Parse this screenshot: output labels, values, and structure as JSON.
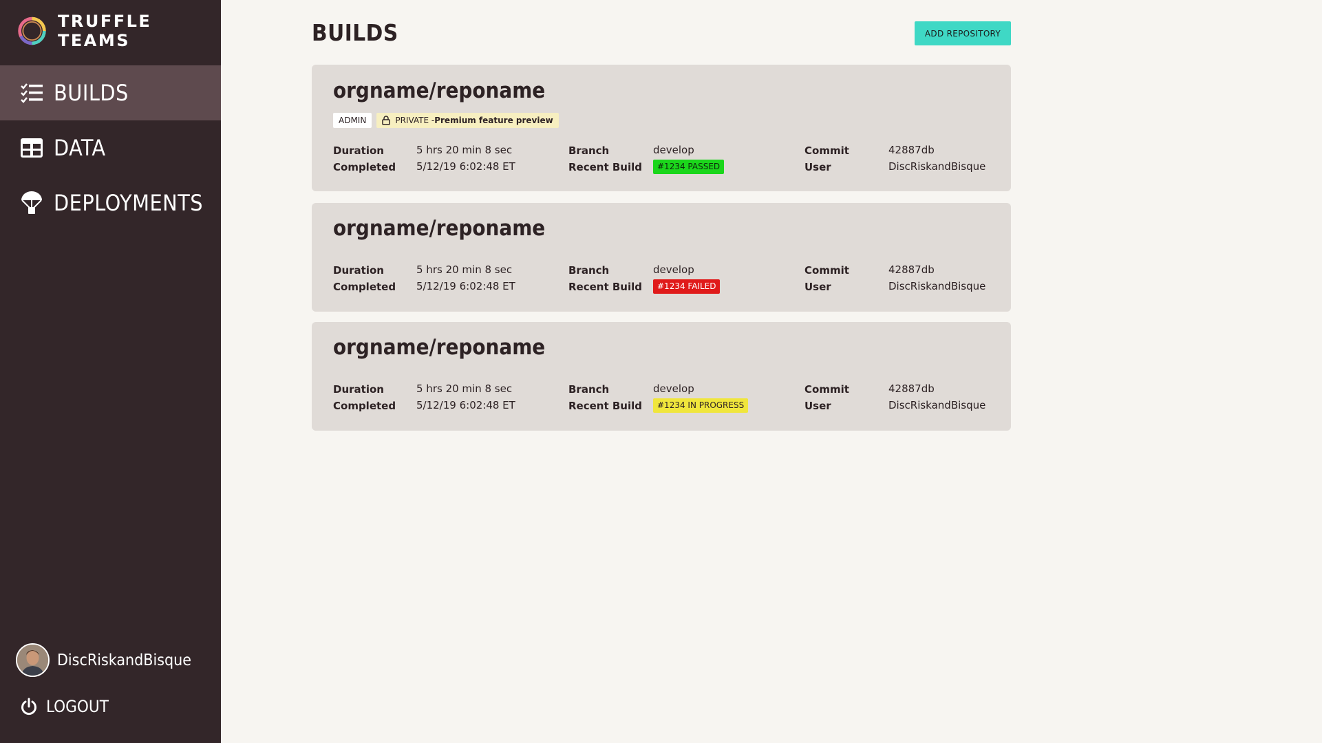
{
  "brand": {
    "name": "TRUFFLE TEAMS"
  },
  "sidebar": {
    "items": [
      {
        "label": "BUILDS",
        "icon": "builds-list-icon",
        "active": true
      },
      {
        "label": "DATA",
        "icon": "data-table-icon",
        "active": false
      },
      {
        "label": "DEPLOYMENTS",
        "icon": "parachute-icon",
        "active": false
      }
    ],
    "user": {
      "name": "DiscRiskandBisque"
    },
    "logout_label": "LOGOUT"
  },
  "main": {
    "title": "BUILDS",
    "add_repository_label": "ADD REPOSITORY"
  },
  "labels": {
    "duration": "Duration",
    "completed": "Completed",
    "branch": "Branch",
    "recent_build": "Recent Build",
    "commit": "Commit",
    "user": "User"
  },
  "builds": [
    {
      "repo": "orgname/reponame",
      "tags": {
        "admin": "ADMIN",
        "private": "PRIVATE - ",
        "private_bold": "Premium feature preview"
      },
      "duration": "5 hrs 20 min 8 sec",
      "completed": "5/12/19 6:02:48 ET",
      "branch": "develop",
      "recent_build": "#1234 PASSED",
      "status": "passed",
      "commit": "42887db",
      "user": "DiscRiskandBisque"
    },
    {
      "repo": "orgname/reponame",
      "duration": "5 hrs 20 min 8 sec",
      "completed": "5/12/19 6:02:48 ET",
      "branch": "develop",
      "recent_build": "#1234 FAILED",
      "status": "failed",
      "commit": "42887db",
      "user": "DiscRiskandBisque"
    },
    {
      "repo": "orgname/reponame",
      "duration": "5 hrs 20 min 8 sec",
      "completed": "5/12/19 6:02:48 ET",
      "branch": "develop",
      "recent_build": "#1234 IN PROGRESS",
      "status": "in-progress",
      "commit": "42887db",
      "user": "DiscRiskandBisque"
    }
  ],
  "colors": {
    "sidebar_bg": "#332629",
    "sidebar_active": "#5e4a4e",
    "accent": "#3fd8c5",
    "passed": "#1bd61b",
    "failed": "#e01a1a",
    "in_progress": "#f0e63c"
  }
}
